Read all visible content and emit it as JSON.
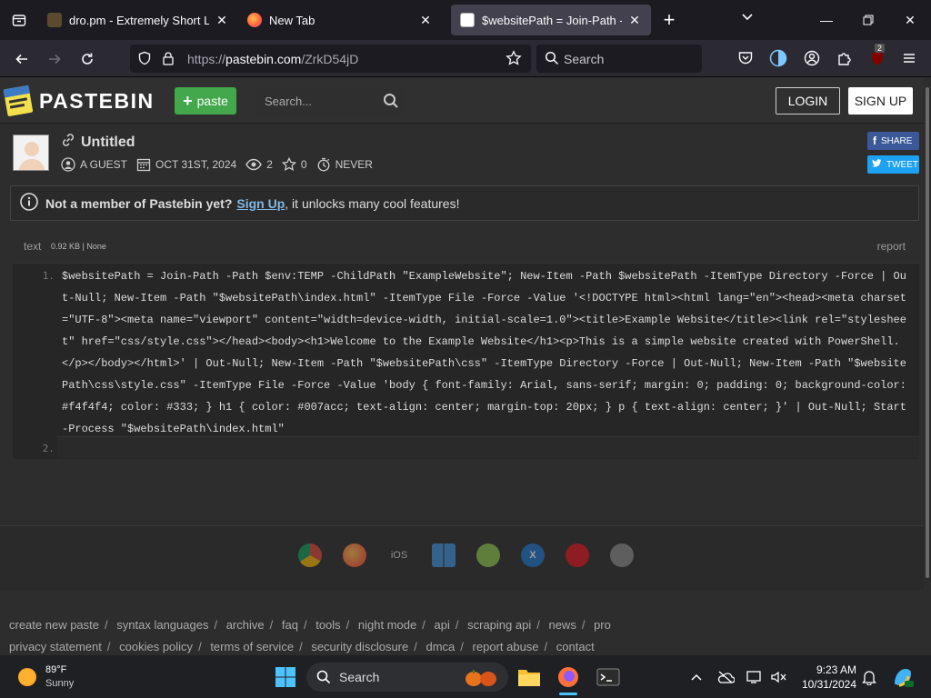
{
  "browser": {
    "tabs": [
      {
        "title": "dro.pm - Extremely Short Links",
        "active": false
      },
      {
        "title": "New Tab",
        "active": false
      },
      {
        "title": "$websitePath = Join-Path -Path",
        "active": true
      }
    ],
    "url_prefix": "https://",
    "url_domain": "pastebin.com",
    "url_path": "/ZrkD54jD",
    "search_placeholder": "Search",
    "extension_badge": "2"
  },
  "site": {
    "logo": "PASTEBIN",
    "paste_button": "paste",
    "search_placeholder": "Search...",
    "login": "LOGIN",
    "signup": "SIGN UP"
  },
  "paste": {
    "title": "Untitled",
    "author": "A GUEST",
    "date": "OCT 31ST, 2024",
    "views": "2",
    "stars": "0",
    "expiry": "NEVER",
    "share": "SHARE",
    "tweet": "TWEET"
  },
  "notice": {
    "lead": "Not a member of Pastebin yet?",
    "link": "Sign Up",
    "tail": ", it unlocks many cool features!"
  },
  "code": {
    "syntax": "text",
    "size": "0.92 KB | None",
    "report": "report",
    "line1_num": "1.",
    "line2_num": "2.",
    "line1": "$websitePath = Join-Path -Path $env:TEMP -ChildPath \"ExampleWebsite\"; New-Item -Path $websitePath -ItemType Directory -Force | Out-Null; New-Item -Path \"$websitePath\\index.html\" -ItemType File -Force -Value '<!DOCTYPE html><html lang=\"en\"><head><meta charset=\"UTF-8\"><meta name=\"viewport\" content=\"width=device-width, initial-scale=1.0\"><title>Example Website</title><link rel=\"stylesheet\" href=\"css/style.css\"></head><body><h1>Welcome to the Example Website</h1><p>This is a simple website created with PowerShell.</p></body></html>' | Out-Null; New-Item -Path \"$websitePath\\css\" -ItemType Directory -Force | Out-Null; New-Item -Path \"$websitePath\\css\\style.css\" -ItemType File -Force -Value 'body { font-family: Arial, sans-serif; margin: 0; padding: 0; background-color: #f4f4f4; color: #333; } h1 { color: #007acc; text-align: center; margin-top: 20px; } p { text-align: center; }' | Out-Null; Start-Process \"$websitePath\\index.html\""
  },
  "apps": {
    "ios_label": "iOS"
  },
  "footer": {
    "row1": [
      "create new paste",
      "syntax languages",
      "archive",
      "faq",
      "tools",
      "night mode",
      "api",
      "scraping api",
      "news",
      "pro"
    ],
    "row2": [
      "privacy statement",
      "cookies policy",
      "terms of service",
      "security disclosure",
      "dmca",
      "report abuse",
      "contact"
    ]
  },
  "taskbar": {
    "temp": "89°F",
    "condition": "Sunny",
    "search": "Search",
    "time": "9:23 AM",
    "date": "10/31/2024"
  }
}
